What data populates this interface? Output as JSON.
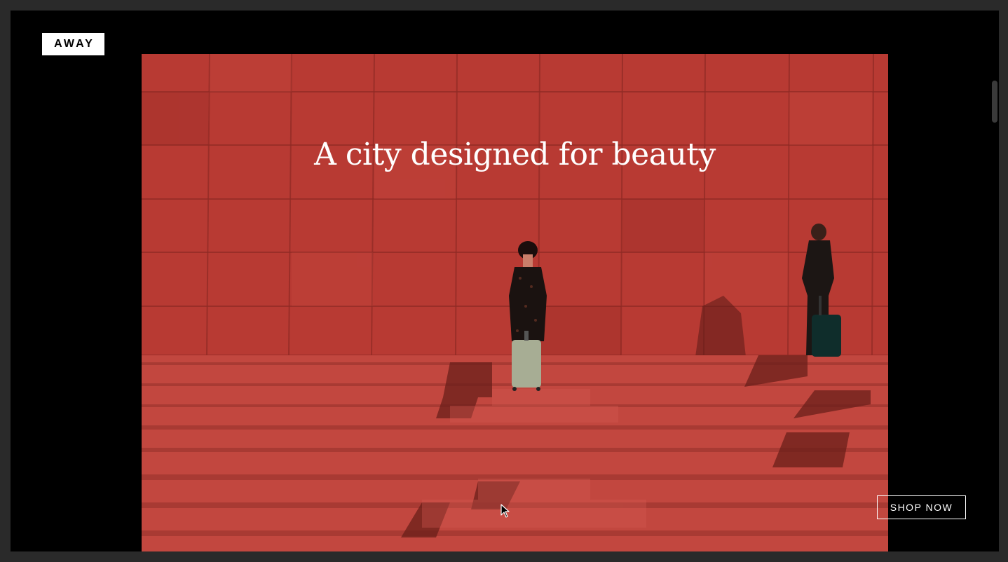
{
  "header": {
    "logo_text": "AWAY"
  },
  "hero": {
    "headline": "A city designed for beauty",
    "cta_label": "SHOP NOW"
  },
  "colors": {
    "page_background": "#000000",
    "wall_red": "#b63a34",
    "steps_red": "#c24a42",
    "white": "#ffffff"
  },
  "icons": {
    "cursor": "mouse-pointer-icon"
  }
}
